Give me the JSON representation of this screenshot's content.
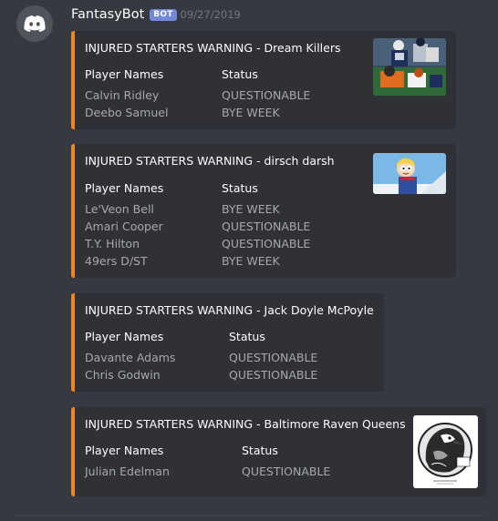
{
  "message": {
    "username": "FantasyBot",
    "bot_tag": "BOT",
    "timestamp": "09/27/2019",
    "avatar_icon": "discord-logo-icon",
    "accent_color": "#f0861f"
  },
  "embeds": [
    {
      "title": "INJURED STARTERS WARNING - Dream Killers",
      "col1_header": "Player Names",
      "col2_header": "Status",
      "players": [
        "Calvin Ridley",
        "Deebo Samuel"
      ],
      "statuses": [
        "QUESTIONABLE",
        "BYE WEEK"
      ],
      "thumbnail": "football-action-photo"
    },
    {
      "title": "INJURED STARTERS WARNING - dirsch darsh",
      "col1_header": "Player Names",
      "col2_header": "Status",
      "players": [
        "Le'Veon Bell",
        "Amari Cooper",
        "T.Y. Hilton",
        "49ers D/ST"
      ],
      "statuses": [
        "BYE WEEK",
        "QUESTIONABLE",
        "QUESTIONABLE",
        "BYE WEEK"
      ],
      "thumbnail": "cartoon-character-image"
    },
    {
      "title": "INJURED STARTERS WARNING - Jack Doyle McPoyle",
      "col1_header": "Player Names",
      "col2_header": "Status",
      "players": [
        "Davante Adams",
        "Chris Godwin"
      ],
      "statuses": [
        "QUESTIONABLE",
        "QUESTIONABLE"
      ]
    },
    {
      "title": "INJURED STARTERS WARNING - Baltimore Raven Queens",
      "col1_header": "Player Names",
      "col2_header": "Status",
      "players": [
        "Julian Edelman"
      ],
      "statuses": [
        "QUESTIONABLE"
      ],
      "thumbnail": "raven-sketch-image"
    }
  ]
}
